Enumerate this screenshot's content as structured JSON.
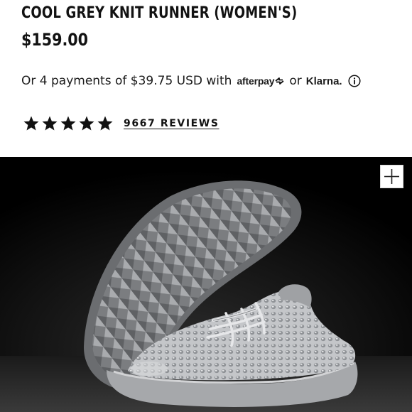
{
  "product": {
    "title": "COOL GREY KNIT RUNNER (WOMEN'S)",
    "price": "$159.00"
  },
  "payments": {
    "prefix": "Or 4 payments of $39.75 USD with",
    "afterpay_label": "afterpay",
    "connector": "or",
    "klarna_label": "Klarna."
  },
  "rating": {
    "stars": 5,
    "max_stars": 5,
    "reviews_label": "9667 REVIEWS"
  },
  "image": {
    "alt_subject": "grey knit running shoes",
    "zoom_icon": "plus-icon"
  },
  "colors": {
    "text": "#121212",
    "image_bg": "#000000",
    "shoe_grey": "#b9bbbe"
  }
}
